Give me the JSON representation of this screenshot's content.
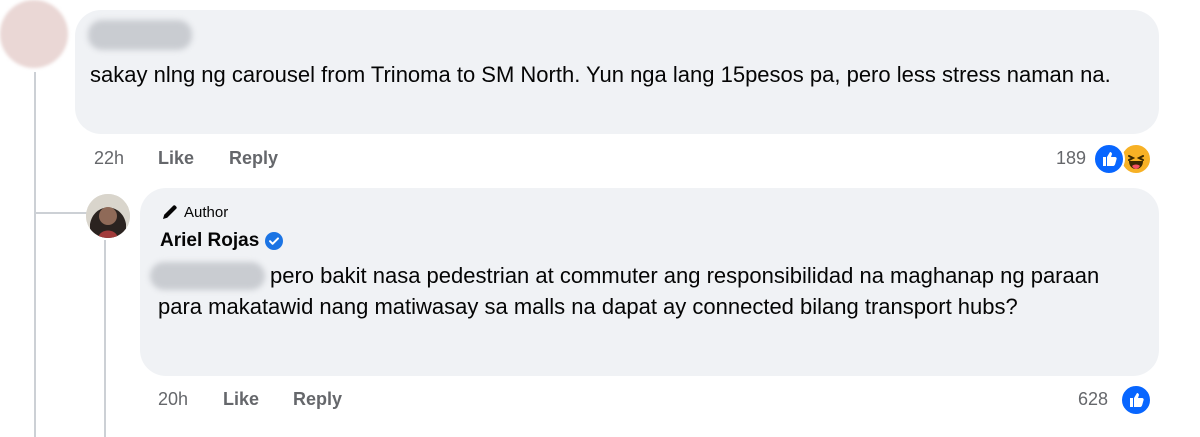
{
  "comment1": {
    "text": "sakay nlng ng carousel from Trinoma to SM North. Yun nga lang 15pesos pa, pero less stress naman na.",
    "time": "22h",
    "like_label": "Like",
    "reply_label": "Reply",
    "reaction_count": "189",
    "reactions": [
      "like-icon",
      "haha-icon"
    ]
  },
  "reply1": {
    "badge_label": "Author",
    "author_name": "Ariel Rojas",
    "text": "pero bakit nasa pedestrian at commuter ang responsibilidad na maghanap ng paraan para makatawid nang matiwasay sa malls na dapat ay connected bilang transport hubs?",
    "time": "20h",
    "like_label": "Like",
    "reply_label": "Reply",
    "reaction_count": "628",
    "reactions": [
      "like-icon"
    ]
  },
  "colors": {
    "bubble": "#f0f2f5",
    "meta_text": "#65676b",
    "like_blue": "#0866ff",
    "verified_blue": "#1b74e4"
  }
}
